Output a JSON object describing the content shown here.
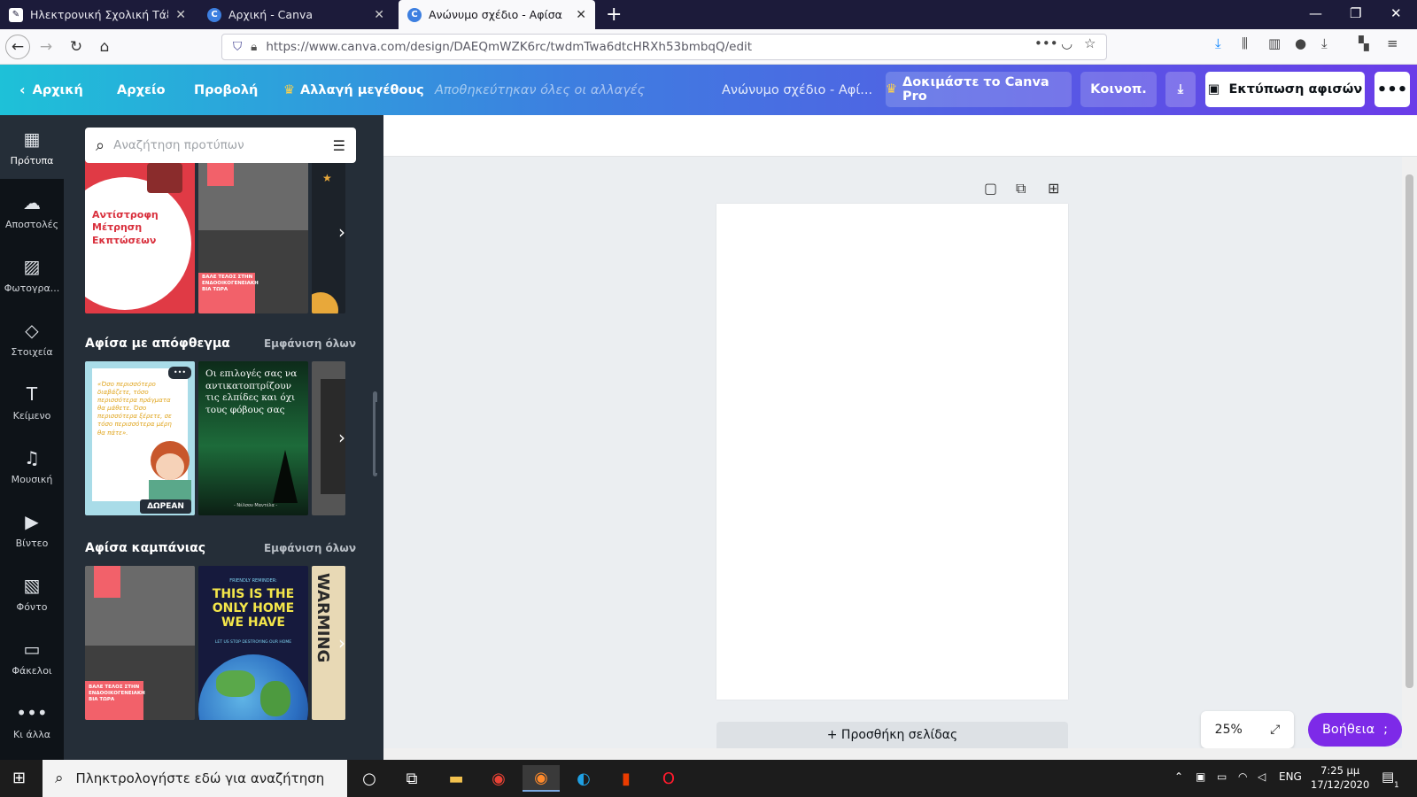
{
  "browser": {
    "tabs": [
      {
        "title": "Ηλεκτρονική Σχολική Τάξη (η-Τ",
        "icon": "eclass-icon"
      },
      {
        "title": "Αρχική - Canva",
        "icon": "canva-icon"
      },
      {
        "title": "Ανώνυμο σχέδιο - Αφίσα",
        "icon": "canva-icon",
        "active": true
      }
    ],
    "new_tab": "+",
    "url": "https://www.canva.com/design/DAEQmWZK6rc/twdmTwa6dtcHRXh53bmbqQ/edit",
    "url_dots": "•••"
  },
  "header": {
    "back_label": "Αρχική",
    "file_label": "Αρχείο",
    "view_label": "Προβολή",
    "resize_label": "Αλλαγή μεγέθους",
    "save_status": "Αποθηκεύτηκαν όλες οι αλλαγές",
    "design_title": "Ανώνυμο σχέδιο - Αφί...",
    "try_pro_label": "Δοκιμάστε το Canva Pro",
    "share_label": "Κοινοπ.",
    "print_label": "Εκτύπωση αφισών",
    "more_label": "•••",
    "accent_color": "#7d2ae8"
  },
  "rail": {
    "items": [
      {
        "label": "Πρότυπα",
        "icon": "templates-icon",
        "active": true
      },
      {
        "label": "Αποστολές",
        "icon": "upload-cloud-icon"
      },
      {
        "label": "Φωτογρα...",
        "icon": "photo-icon"
      },
      {
        "label": "Στοιχεία",
        "icon": "elements-icon"
      },
      {
        "label": "Κείμενο",
        "icon": "text-icon"
      },
      {
        "label": "Μουσική",
        "icon": "music-icon"
      },
      {
        "label": "Βίντεο",
        "icon": "video-icon"
      },
      {
        "label": "Φόντο",
        "icon": "background-icon"
      },
      {
        "label": "Φάκελοι",
        "icon": "folder-icon"
      },
      {
        "label": "Κι άλλα",
        "icon": "more-icon"
      }
    ]
  },
  "panel": {
    "search_placeholder": "Αναζήτηση προτύπων",
    "sections": [
      {
        "title": "",
        "see_all": ""
      },
      {
        "title": "Αφίσα με απόφθεγμα",
        "see_all": "Εμφάνιση όλων"
      },
      {
        "title": "Αφίσα καμπάνιας",
        "see_all": "Εμφάνιση όλων"
      }
    ],
    "thumbs": {
      "countdown_title": "Αντίστροφη Μέτρηση Εκπτώσεων",
      "violence_text": "ΒΑΛΕ ΤΕΛΟΣ ΣΤΗΝ ΕΝΔΟΟΙΚΟΓΕΝΕΙΑΚΗ ΒΙΑ ΤΩΡΑ",
      "quote1_text": "«Όσο περισσότερο διαβάζετε, τόσο περισσότερα πράγματα θα μάθετε. Όσο περισσότερα ξέρετε, σε τόσο περισσότερα μέρη θα πάτε».",
      "free_badge": "ΔΩΡΕΑΝ",
      "quote2_text": "Οι επιλογές σας να αντικατοπτρίζουν τις ελπίδες και όχι τους φόβους σας",
      "quote2_author": "- Νέλσον Μαντέλα -",
      "home_small": "FRIENDLY REMINDER:",
      "home_title": "THIS IS THE ONLY HOME WE HAVE",
      "home_sub": "LET US STOP DESTROYING OUR HOME",
      "warming_text": "WARMING"
    }
  },
  "canvas": {
    "add_page_label": "+ Προσθήκη σελίδας",
    "zoom_level": "25%",
    "help_label": "Βοήθεια",
    "help_suffix": ";"
  },
  "taskbar": {
    "search_placeholder": "Πληκτρολογήστε εδώ για αναζήτηση",
    "language": "ENG",
    "time": "7:25 μμ",
    "date": "17/12/2020",
    "notification_count": "1"
  }
}
